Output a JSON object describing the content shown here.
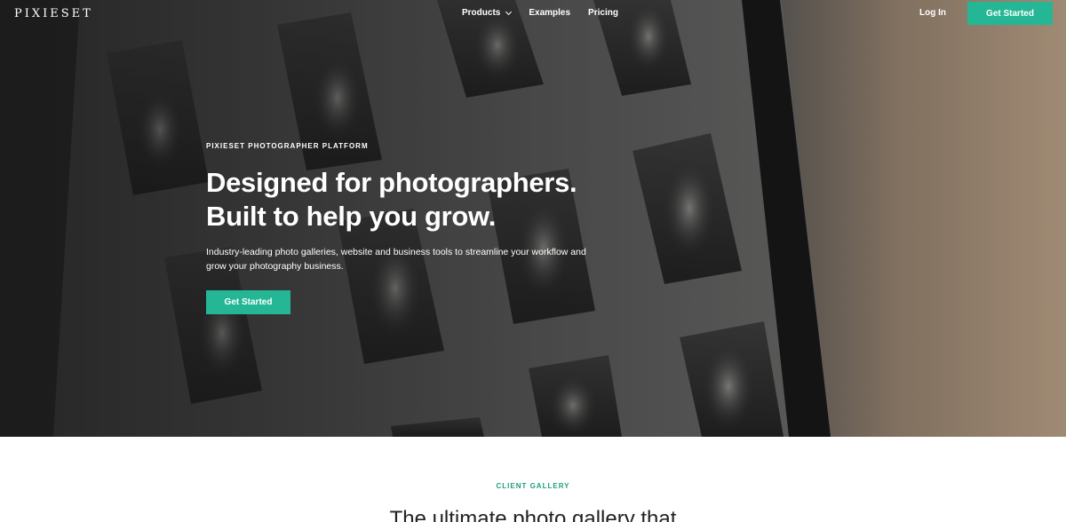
{
  "nav": {
    "logo": "PIXIESET",
    "links": [
      {
        "label": "Products",
        "has_dropdown": true
      },
      {
        "label": "Examples"
      },
      {
        "label": "Pricing"
      }
    ],
    "login": "Log In",
    "cta": "Get Started"
  },
  "hero": {
    "eyebrow": "PIXIESET PHOTOGRAPHER PLATFORM",
    "headline_line1": "Designed for photographers.",
    "headline_line2": "Built to help you grow.",
    "subcopy": "Industry-leading photo galleries, website and business tools to streamline your workflow and grow your photography business.",
    "cta": "Get Started"
  },
  "section": {
    "eyebrow": "CLIENT GALLERY",
    "title": "The ultimate photo gallery that"
  },
  "colors": {
    "accent": "#25b795",
    "eyebrow_green": "#1e9f81"
  }
}
